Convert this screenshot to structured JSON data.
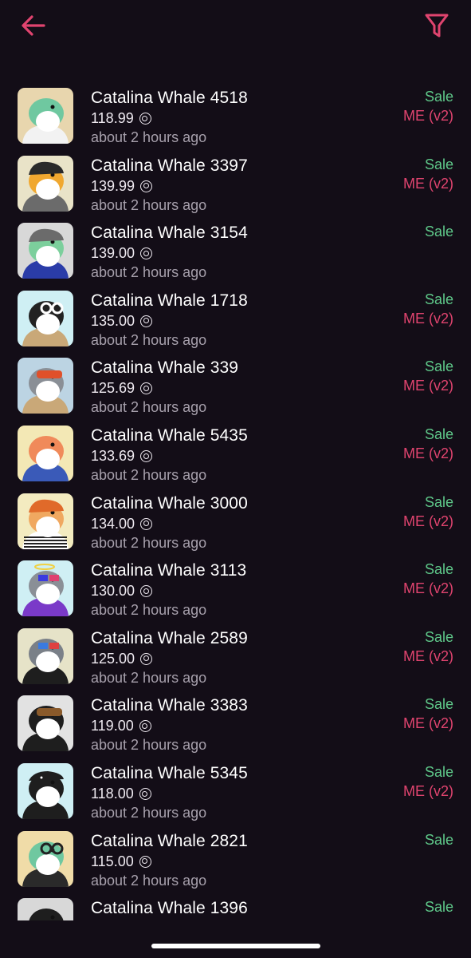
{
  "header": {
    "back_icon": "arrow-left-icon",
    "filter_icon": "filter-icon",
    "accent_color": "#e0446f"
  },
  "colors": {
    "background": "#130d17",
    "sale": "#5fc98a",
    "marketplace": "#e0446f",
    "muted": "#a7a0ac"
  },
  "currency_icon": "solana-icon",
  "items": [
    {
      "name": "Catalina Whale 4518",
      "price": "118.99",
      "time": "about 2 hours ago",
      "type": "Sale",
      "market": "ME (v2)",
      "bg": "#e8d6ae",
      "skin": "#6fc8a0",
      "accessory": "none",
      "cloth": "#f2f2f2"
    },
    {
      "name": "Catalina Whale 3397",
      "price": "139.99",
      "time": "about 2 hours ago",
      "type": "Sale",
      "market": "ME (v2)",
      "bg": "#e9e3c8",
      "skin": "#f0a830",
      "accessory": "beanie",
      "cloth": "#6b6b6b"
    },
    {
      "name": "Catalina Whale 3154",
      "price": "139.00",
      "time": "about 2 hours ago",
      "type": "Sale",
      "market": "",
      "bg": "#d8d8d8",
      "skin": "#7ccf9c",
      "accessory": "cap",
      "cloth": "#2a3ca8"
    },
    {
      "name": "Catalina Whale 1718",
      "price": "135.00",
      "time": "about 2 hours ago",
      "type": "Sale",
      "market": "ME (v2)",
      "bg": "#cfeff4",
      "skin": "#222222",
      "accessory": "glasses",
      "cloth": "#c9a878"
    },
    {
      "name": "Catalina Whale 339",
      "price": "125.69",
      "time": "about 2 hours ago",
      "type": "Sale",
      "market": "ME (v2)",
      "bg": "#bcd4e3",
      "skin": "#8a8f96",
      "accessory": "goggles",
      "cloth": "#c9a878"
    },
    {
      "name": "Catalina Whale 5435",
      "price": "133.69",
      "time": "about 2 hours ago",
      "type": "Sale",
      "market": "ME (v2)",
      "bg": "#f3e8b5",
      "skin": "#f08a5a",
      "accessory": "none",
      "cloth": "#3a5ab8"
    },
    {
      "name": "Catalina Whale 3000",
      "price": "134.00",
      "time": "about 2 hours ago",
      "type": "Sale",
      "market": "ME (v2)",
      "bg": "#f3ebc0",
      "skin": "#f0a860",
      "accessory": "beanie-orange",
      "cloth": "#ffffff"
    },
    {
      "name": "Catalina Whale 3113",
      "price": "130.00",
      "time": "about 2 hours ago",
      "type": "Sale",
      "market": "ME (v2)",
      "bg": "#cfeff4",
      "skin": "#8a8f96",
      "accessory": "halo",
      "cloth": "#7a3ac8"
    },
    {
      "name": "Catalina Whale 2589",
      "price": "125.00",
      "time": "about 2 hours ago",
      "type": "Sale",
      "market": "ME (v2)",
      "bg": "#e6e3c8",
      "skin": "#7a8088",
      "accessory": "3d-glasses",
      "cloth": "#1e1e1e"
    },
    {
      "name": "Catalina Whale 3383",
      "price": "119.00",
      "time": "about 2 hours ago",
      "type": "Sale",
      "market": "ME (v2)",
      "bg": "#e2e2e2",
      "skin": "#1e1e1e",
      "accessory": "goggles-brown",
      "cloth": "#1e1e1e"
    },
    {
      "name": "Catalina Whale 5345",
      "price": "118.00",
      "time": "about 2 hours ago",
      "type": "Sale",
      "market": "ME (v2)",
      "bg": "#cfeff4",
      "skin": "#1e1e1e",
      "accessory": "bandana",
      "cloth": "#1e1e1e"
    },
    {
      "name": "Catalina Whale 2821",
      "price": "115.00",
      "time": "about 2 hours ago",
      "type": "Sale",
      "market": "",
      "bg": "#f0dca8",
      "skin": "#6fc8a0",
      "accessory": "glasses-round",
      "cloth": "#2a2a2a"
    },
    {
      "name": "Catalina Whale 1396",
      "price": "",
      "time": "",
      "type": "Sale",
      "market": "",
      "bg": "#d8d8d8",
      "skin": "#1e1e1e",
      "accessory": "none",
      "cloth": "#1e1e1e"
    }
  ]
}
